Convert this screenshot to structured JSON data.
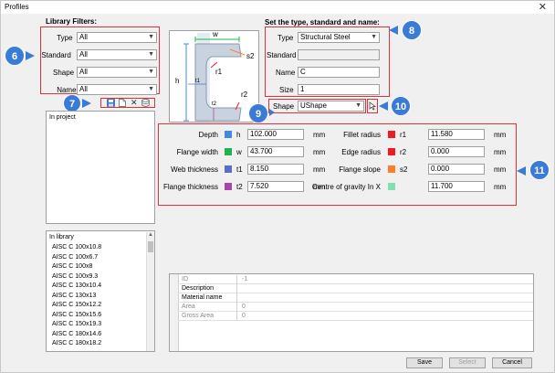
{
  "window": {
    "title": "Profiles",
    "close_glyph": "✕"
  },
  "filters": {
    "heading": "Library Filters:",
    "rows": [
      {
        "label": "Type",
        "value": "All"
      },
      {
        "label": "Standard",
        "value": "All"
      },
      {
        "label": "Shape",
        "value": "All"
      },
      {
        "label": "Name",
        "value": "All"
      }
    ]
  },
  "toolbar_icons": [
    "save-icon",
    "new-icon",
    "delete-icon",
    "database-icon"
  ],
  "delete_glyph": "✕",
  "in_project": {
    "label": "In project"
  },
  "in_library": {
    "label": "In library",
    "items": [
      "AISC C 100x10.8",
      "AISC C 100x6.7",
      "AISC C 100x8",
      "AISC C 100x9.3",
      "AISC C 130x10.4",
      "AISC C 130x13",
      "AISC C 150x12.2",
      "AISC C 150x15.6",
      "AISC C 150x19.3",
      "AISC C 180x14.6",
      "AISC C 180x18.2"
    ]
  },
  "diagram": {
    "labels": {
      "w": "w",
      "s2": "s2",
      "h": "h",
      "r1": "r1",
      "t1": "t1",
      "r2": "r2",
      "t2": "t2"
    }
  },
  "set_type": {
    "heading": "Set the type, standard and name:",
    "type_label": "Type",
    "type_value": "Structural Steel",
    "standard_label": "Standard",
    "standard_value": "",
    "name_label": "Name",
    "name_value": "C",
    "size_label": "Size",
    "size_value": "1",
    "shape_label": "Shape",
    "shape_value": "UShape"
  },
  "params_left": [
    {
      "label": "Depth",
      "sym": "h",
      "value": "102.000",
      "unit": "mm",
      "color": "#3c8de0"
    },
    {
      "label": "Flange width",
      "sym": "w",
      "value": "43.700",
      "unit": "mm",
      "color": "#22b14c"
    },
    {
      "label": "Web thickness",
      "sym": "t1",
      "value": "8.150",
      "unit": "mm",
      "color": "#5a6ec8"
    },
    {
      "label": "Flange thickness",
      "sym": "t2",
      "value": "7.520",
      "unit": "mm",
      "color": "#a349a4"
    }
  ],
  "params_right": [
    {
      "label": "Fillet radius",
      "sym": "r1",
      "value": "11.580",
      "unit": "mm",
      "color": "#ed1c24"
    },
    {
      "label": "Edge radius",
      "sym": "r2",
      "value": "0.000",
      "unit": "mm",
      "color": "#ed1c24"
    },
    {
      "label": "Flange slope",
      "sym": "s2",
      "value": "0.000",
      "unit": "mm",
      "color": "#ff7f27"
    },
    {
      "label": "Centre of gravity In X",
      "sym": "",
      "value": "11.700",
      "unit": "mm",
      "color": "#7fe0b0"
    }
  ],
  "properties": [
    {
      "key": "ID",
      "value": "-1",
      "dim": true
    },
    {
      "key": "Description",
      "value": "",
      "dim": false
    },
    {
      "key": "Material name",
      "value": "",
      "dim": false
    },
    {
      "key": "Area",
      "value": "0",
      "dim": true
    },
    {
      "key": "Gross Area",
      "value": "0",
      "dim": true
    }
  ],
  "buttons": {
    "save": "Save",
    "select": "Select",
    "cancel": "Cancel"
  },
  "badges": {
    "b6": "6",
    "b7": "7",
    "b8": "8",
    "b9": "9",
    "b10": "10",
    "b11": "11"
  }
}
